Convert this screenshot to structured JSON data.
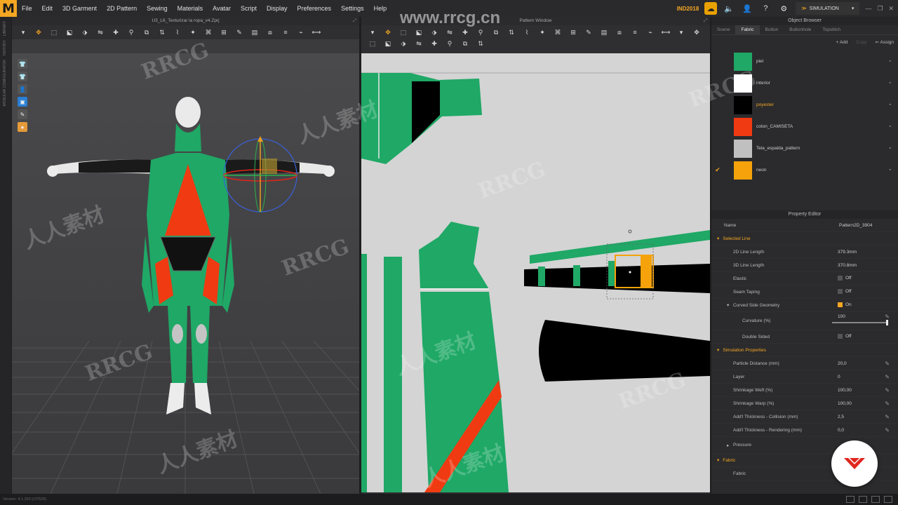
{
  "app": {
    "logo": "M",
    "menu": [
      "File",
      "Edit",
      "3D Garment",
      "2D Pattern",
      "Sewing",
      "Materials",
      "Avatar",
      "Script",
      "Display",
      "Preferences",
      "Settings",
      "Help"
    ],
    "license_label": "IND2018",
    "mode_label": "SIMULATION",
    "window_controls": [
      "—",
      "❐",
      "✕"
    ]
  },
  "left_strip": {
    "labels": [
      "LIBRARY",
      "HISTORY",
      "MODULAR CONFIGURATOR"
    ]
  },
  "window3d": {
    "title": "U3_L6_Texturizar la ropa_v4.Zprj",
    "toolbar_icons": [
      "arrow-down-icon",
      "move-icon",
      "box-select-icon",
      "transform-icon",
      "edit-points-icon",
      "fold-icon",
      "tack-icon",
      "pin-icon",
      "pin-box-icon",
      "strength-icon",
      "avatar-tape-icon",
      "pose-icon",
      "wrap-icon",
      "fit-icon",
      "paint-icon",
      "graphic-icon",
      "texture-icon",
      "zipper-icon",
      "puckering-icon",
      "measure-icon"
    ],
    "side_tools": [
      "garment-view-icon",
      "garment-front-icon",
      "avatar-view-icon",
      "texture-view-icon",
      "edit-texture-icon",
      "camera-icon"
    ]
  },
  "window2d": {
    "title": "Pattern Window",
    "toolbar_icons": [
      "edit-pattern-icon",
      "edit-point-icon",
      "curve-point-icon",
      "add-point-icon",
      "edit-curvature-icon",
      "polygon-icon",
      "rectangle-icon",
      "circle-icon",
      "internal-polygon-icon",
      "internal-rectangle-icon",
      "internal-circle-icon",
      "dart-icon",
      "trace-icon",
      "notch-icon",
      "seam-line-icon",
      "fold-pattern-icon",
      "copy-pattern-icon",
      "symmetry-icon",
      "segment-sewing-icon",
      "free-sewing-icon",
      "tack-pattern-icon",
      "pleat-icon",
      "elastic-icon",
      "fabric-grain-icon",
      "texture-2d-icon",
      "graphic-2d-icon",
      "button-icon",
      "buttonhole-icon",
      "zipper-2d-icon",
      "piping-icon"
    ]
  },
  "object_browser": {
    "title": "Object Browser",
    "tabs": [
      "Scene",
      "Fabric",
      "Button",
      "Buttonhole",
      "Topstitch"
    ],
    "active_tab": "Fabric",
    "actions": {
      "add": "+ Add",
      "copy": "Copy",
      "assign": "⇜ Assign"
    },
    "fabrics": [
      {
        "name": "piel",
        "color": "#1fa866",
        "checked": false,
        "highlight": false
      },
      {
        "name": "interior",
        "color": "#ffffff",
        "checked": false,
        "highlight": false
      },
      {
        "name": "poyester",
        "color": "#000000",
        "checked": false,
        "highlight": true
      },
      {
        "name": "coton_CAMISETA",
        "color": "#f03a12",
        "checked": false,
        "highlight": false
      },
      {
        "name": "Tela_espalda_pattern",
        "color": "#c0c0c0",
        "checked": false,
        "highlight": false
      },
      {
        "name": "neon",
        "color": "#f5a20b",
        "checked": true,
        "highlight": false
      }
    ]
  },
  "property_editor": {
    "title": "Property Editor",
    "name_label": "Name",
    "name_value": "Pattern2D_3904",
    "selected_line": "Selected Line",
    "rows_line": [
      {
        "label": "2D Line Length",
        "value": "379.3mm"
      },
      {
        "label": "3D Line Length",
        "value": "370.8mm"
      },
      {
        "label": "Elastic",
        "value": "Off",
        "checkbox": true,
        "on": false
      },
      {
        "label": "Seam Taping",
        "value": "Off",
        "checkbox": true,
        "on": false
      }
    ],
    "curved": {
      "label": "Curved Side Geometry",
      "value": "On"
    },
    "curvature": {
      "label": "Curvature (%)",
      "value": "100"
    },
    "double_sided": {
      "label": "Double Sided",
      "value": "Off"
    },
    "simulation_properties": "Simulation Properties",
    "rows_sim": [
      {
        "label": "Particle Distance (mm)",
        "value": "20,0"
      },
      {
        "label": "Layer",
        "value": "0"
      },
      {
        "label": "Shrinkage Weft (%)",
        "value": "100,00"
      },
      {
        "label": "Shrinkage Warp (%)",
        "value": "100,00"
      },
      {
        "label": "Add'l Thickness - Collision (mm)",
        "value": "2,5"
      },
      {
        "label": "Add'l Thickness - Rendering (mm)",
        "value": "0,0"
      }
    ],
    "pressure": "Pressure",
    "fabric_section": "Fabric",
    "fabric_row": "Fabric"
  },
  "status": {
    "version": "Version: 4.1.293 (r37529)"
  },
  "watermarks": {
    "top": "www.rrcg.cn",
    "main": "RRCG",
    "cn": "人人素材"
  },
  "colors": {
    "green": "#1fa866",
    "red": "#f03a12",
    "black": "#000000",
    "orange": "#f5a20b",
    "accent": "#f5a623",
    "gizmo_blue": "#3a5fd8"
  }
}
